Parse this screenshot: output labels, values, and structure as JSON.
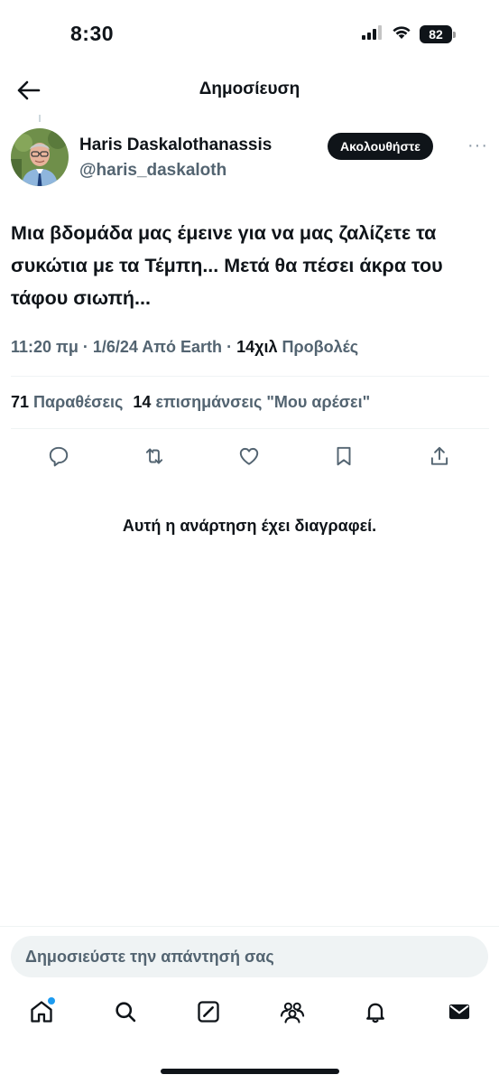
{
  "status_bar": {
    "time": "8:30",
    "battery": "82"
  },
  "header": {
    "title": "Δημοσίευση"
  },
  "post": {
    "author": {
      "display_name": "Haris Daskalothanassis",
      "handle": "@haris_daskaloth"
    },
    "follow_label": "Ακολουθήστε",
    "more_label": "···",
    "text": "Μια βδομάδα μας έμεινε για να μας ζαλίζετε τα συκώτια με τα Τέμπη... Μετά θα πέσει άκρα του τάφου σιωπή...",
    "meta": {
      "time": "11:20 πμ",
      "date": "1/6/24",
      "source": "Από Earth",
      "views_count": "14χιλ",
      "views_label": "Προβολές"
    },
    "stats": {
      "quotes_count": "71",
      "quotes_label": "Παραθέσεις",
      "likes_count": "14",
      "likes_label": "επισημάνσεις \"Μου αρέσει\""
    },
    "deleted_notice": "Αυτή η ανάρτηση έχει διαγραφεί."
  },
  "actions": [
    "reply-icon",
    "repost-icon",
    "like-icon",
    "bookmark-icon",
    "share-icon"
  ],
  "reply": {
    "placeholder": "Δημοσιεύστε την απάντησή σας"
  },
  "tabs": [
    "home-icon",
    "search-icon",
    "grok-icon",
    "communities-icon",
    "notifications-icon",
    "messages-icon"
  ],
  "colors": {
    "text": "#0f1419",
    "secondary": "#536471",
    "accent": "#1d9bf0",
    "divider": "#eff3f4"
  }
}
